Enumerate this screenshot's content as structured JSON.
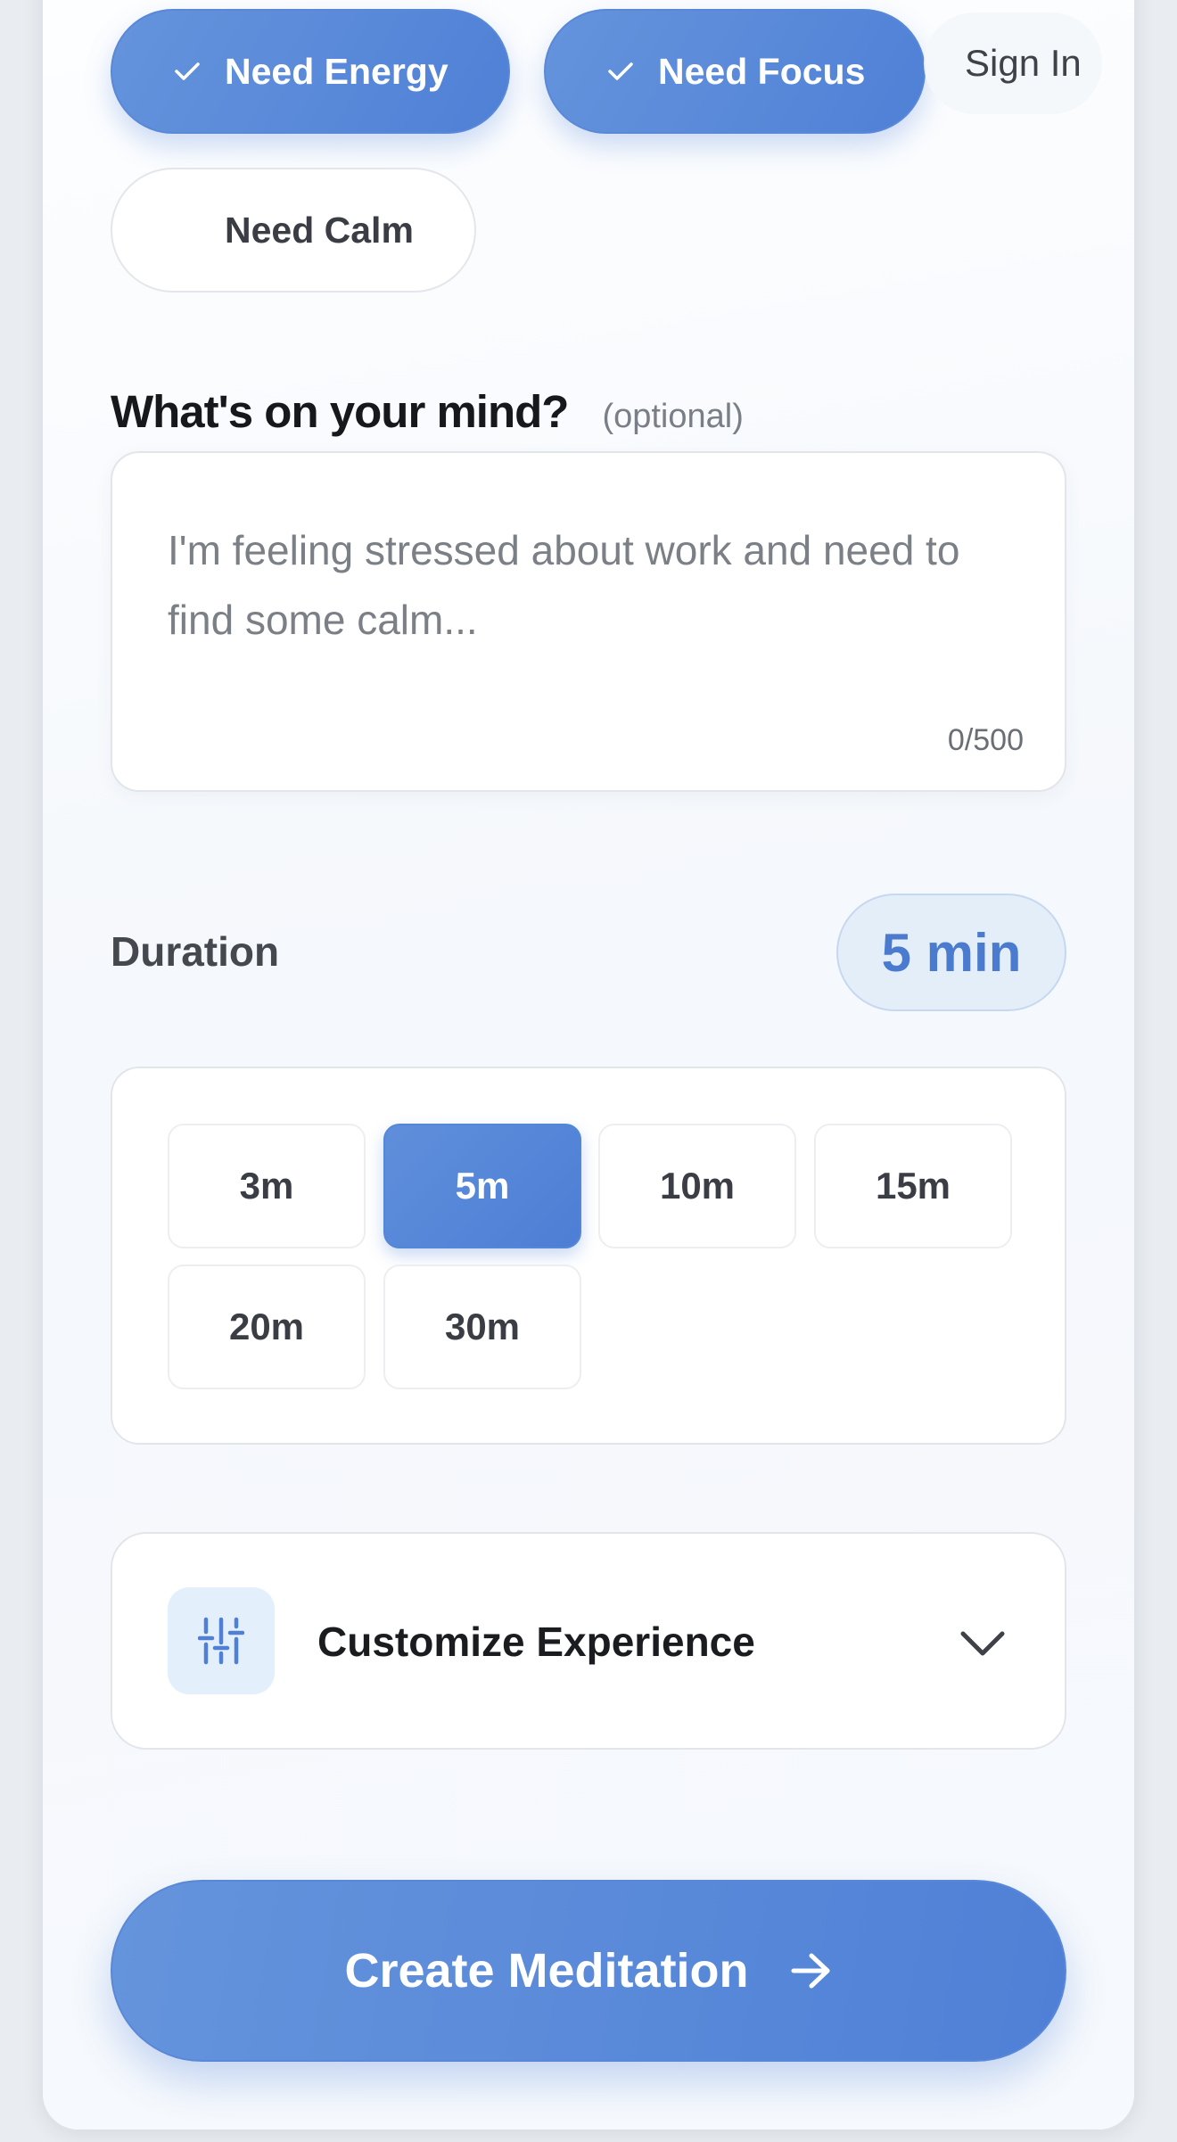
{
  "feelings": [
    {
      "label": "Need Energy",
      "selected": true
    },
    {
      "label": "Need Focus",
      "selected": true
    },
    {
      "label": "Need Calm",
      "selected": false
    }
  ],
  "header": {
    "sign_in_label": "Sign In"
  },
  "mind": {
    "heading": "What's on your mind?",
    "optional_label": "(optional)",
    "placeholder": "I'm feeling stressed about work and need to find some calm...",
    "value": "",
    "char_count": "0/500"
  },
  "duration": {
    "label": "Duration",
    "selected_display": "5 min",
    "options": [
      {
        "label": "3m",
        "selected": false
      },
      {
        "label": "5m",
        "selected": true
      },
      {
        "label": "10m",
        "selected": false
      },
      {
        "label": "15m",
        "selected": false
      },
      {
        "label": "20m",
        "selected": false
      },
      {
        "label": "30m",
        "selected": false
      }
    ]
  },
  "customize": {
    "label": "Customize Experience",
    "expanded": false
  },
  "cta": {
    "label": "Create Meditation"
  },
  "colors": {
    "accent": "#4f80d6",
    "accent_light": "#e4eef9",
    "text_dark": "#16181c"
  },
  "icons": {
    "check": "check-icon",
    "sliders": "sliders-icon",
    "chevron": "chevron-down-icon",
    "arrow": "arrow-right-icon"
  }
}
